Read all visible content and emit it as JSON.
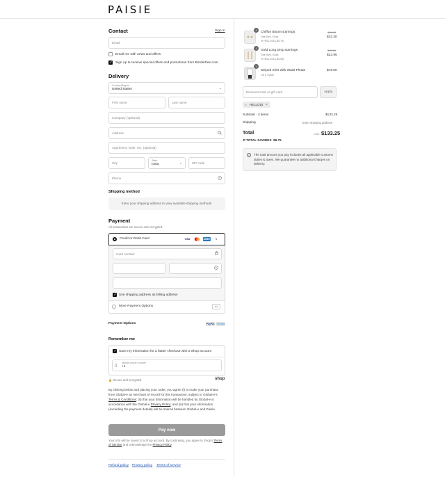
{
  "brand": {
    "logo": "PAISIE"
  },
  "contact": {
    "title": "Contact",
    "sign_in": "Sign in",
    "email_placeholder": "Email",
    "news_label": "Email me with news and offers",
    "promo_label": "Sign up to receive special offers and promotions from Borderfree.com."
  },
  "delivery": {
    "title": "Delivery",
    "country_label": "Country/Region",
    "country_value": "United States",
    "first_name": "First name",
    "last_name": "Last name",
    "company": "Company (optional)",
    "address": "Address",
    "apartment": "Apartment, suite, etc. (optional)",
    "city": "City",
    "state_label": "State",
    "state_value": "Iowa",
    "zip": "ZIP code",
    "phone": "Phone"
  },
  "shipping_method": {
    "title": "Shipping method",
    "notice": "Enter your shipping address to view available shipping methods."
  },
  "payment": {
    "title": "Payment",
    "subtitle": "All transactions are secure and encrypted.",
    "credit_label": "Credit or Debit Card",
    "card_brands": [
      "VISA",
      "MC",
      "AMEX",
      "+1"
    ],
    "card_number": "Card number",
    "billing_same": "Use shipping address as billing address",
    "more_options": "More Payment Options",
    "more_dots": "•••"
  },
  "payment_options": {
    "title": "Payment Options",
    "paypal": "PayPal",
    "venmo": "Venmo"
  },
  "remember": {
    "title": "Remember me",
    "save_label": "Save my information for a faster checkout with a Shop account",
    "mobile_label": "Mobile phone number",
    "mobile_prefix": "+1",
    "secure": "Secure and encrypted",
    "shop": "shop"
  },
  "legal": {
    "p1": "By clicking below and placing your order, you agree (i) to make your purchase from Global-e as merchant of record for this transaction, subject to Global-e's",
    "terms_link": "Terms & Conditions",
    "p2": "; (ii) that your information will be handled by Global-e in accordance with the Global-e",
    "privacy_link": "Privacy Policy",
    "p3": "; and (iii) that your information (excluding the payment details) will be shared between Global-e and Paisie."
  },
  "pay_button": "Pay now",
  "shop_notice": {
    "p1": "Your info will be saved to a Shop account. By continuing, you agree to Shop's",
    "tos": "Terms of Service",
    "mid": "and acknowledge the",
    "privacy": "Privacy Policy",
    "end": "."
  },
  "footer_links": [
    "Refund policy",
    "Privacy policy",
    "Terms of service"
  ],
  "cart": {
    "items": [
      {
        "qty": "1",
        "name": "Chiffon Bloom Earrings",
        "variant": "One Size / Gold",
        "discount": "HELLO15 (-$5.70)",
        "old_price": "$38.00",
        "price": "$32.30"
      },
      {
        "qty": "1",
        "name": "Gold Long Drop Earrings",
        "variant": "One Size / Gold",
        "discount": "HELLO15 (-$4.05)",
        "old_price": "$27.00",
        "price": "$22.95"
      },
      {
        "qty": "1",
        "name": "Striped Shirt with Waist Pleats",
        "variant": "US 6 / Multi",
        "discount": "",
        "old_price": "",
        "price": "$78.00"
      }
    ],
    "discount_placeholder": "Discount code or gift card",
    "apply": "Apply",
    "code_tag": "HELLO15",
    "subtotal_label": "Subtotal · 3 items",
    "subtotal_value": "$133.25",
    "shipping_label": "Shipping",
    "shipping_value": "Enter shipping address",
    "total_label": "Total",
    "currency": "USD",
    "total_value": "$133.25",
    "savings_label": "TOTAL SAVINGS",
    "savings_value": "$9.75",
    "info": "The total amount you pay includes all applicable customs duties & taxes. We guarantee no additional charges on delivery."
  }
}
